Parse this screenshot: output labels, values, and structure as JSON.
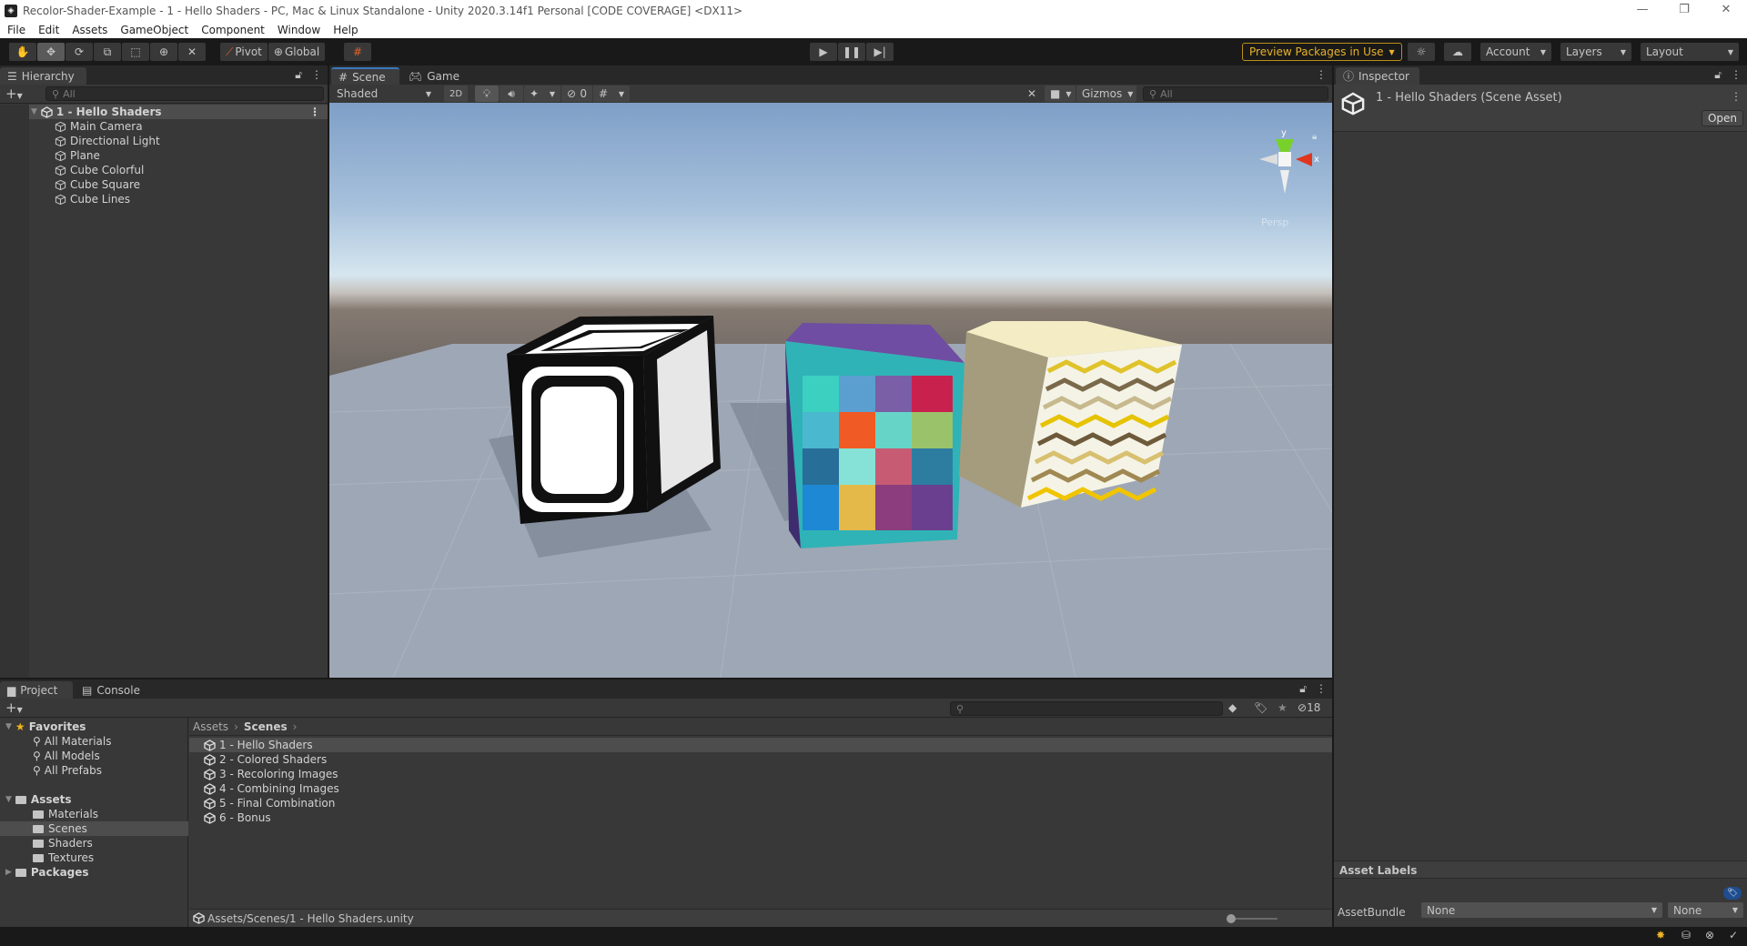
{
  "window": {
    "title": "Recolor-Shader-Example - 1 - Hello Shaders - PC, Mac & Linux Standalone - Unity 2020.3.14f1 Personal [CODE COVERAGE] <DX11>",
    "controls": [
      "minimize",
      "restore",
      "close"
    ]
  },
  "menu": [
    "File",
    "Edit",
    "Assets",
    "GameObject",
    "Component",
    "Window",
    "Help"
  ],
  "toolbar": {
    "tools": [
      {
        "name": "hand-tool",
        "icon": "hand"
      },
      {
        "name": "move-tool",
        "icon": "move",
        "active": true
      },
      {
        "name": "rotate-tool",
        "icon": "rotate"
      },
      {
        "name": "scale-tool",
        "icon": "scale"
      },
      {
        "name": "rect-tool",
        "icon": "rect"
      },
      {
        "name": "transform-tool",
        "icon": "transform"
      },
      {
        "name": "custom-tool",
        "icon": "tools"
      }
    ],
    "pivot_label": "Pivot",
    "global_label": "Global",
    "preview_packages_label": "Preview Packages in Use",
    "account_label": "Account",
    "layers_label": "Layers",
    "layout_label": "Layout",
    "accent_color": "#e9b32a"
  },
  "hierarchy": {
    "tab_label": "Hierarchy",
    "search_placeholder": "All",
    "scene_name": "1 - Hello Shaders",
    "items": [
      "Main Camera",
      "Directional Light",
      "Plane",
      "Cube Colorful",
      "Cube Square",
      "Cube Lines"
    ]
  },
  "scene_view": {
    "tabs": [
      "Scene",
      "Game"
    ],
    "active_tab": "Scene",
    "shading_mode": "Shaded",
    "mode_2d_label": "2D",
    "hidden_count": "0",
    "gizmos_label": "Gizmos",
    "search_placeholder": "All",
    "gizmo_axes": {
      "y": "y",
      "x": "x"
    },
    "projection_label": "Persp",
    "objects": [
      "Cube Square",
      "Cube Colorful",
      "Cube Lines"
    ]
  },
  "inspector": {
    "tab_label": "Inspector",
    "asset_title": "1 - Hello Shaders (Scene Asset)",
    "open_label": "Open",
    "asset_labels_title": "Asset Labels",
    "asset_bundle_label": "AssetBundle",
    "asset_bundle_value": "None",
    "asset_bundle_variant": "None"
  },
  "project": {
    "tabs": [
      "Project",
      "Console"
    ],
    "active_tab": "Project",
    "favorites_label": "Favorites",
    "favorites": [
      "All Materials",
      "All Models",
      "All Prefabs"
    ],
    "assets_label": "Assets",
    "asset_folders": [
      "Materials",
      "Scenes",
      "Shaders",
      "Textures"
    ],
    "selected_folder": "Scenes",
    "packages_label": "Packages",
    "breadcrumb": [
      "Assets",
      "Scenes"
    ],
    "files": [
      "1 - Hello Shaders",
      "2 - Colored Shaders",
      "3 - Recoloring Images",
      "4 - Combining Images",
      "5 - Final Combination",
      "6 - Bonus"
    ],
    "selected_file": "1 - Hello Shaders",
    "hidden_packages_count": "18",
    "selected_path": "Assets/Scenes/1 - Hello Shaders.unity",
    "zoom_slider": 0.0
  }
}
